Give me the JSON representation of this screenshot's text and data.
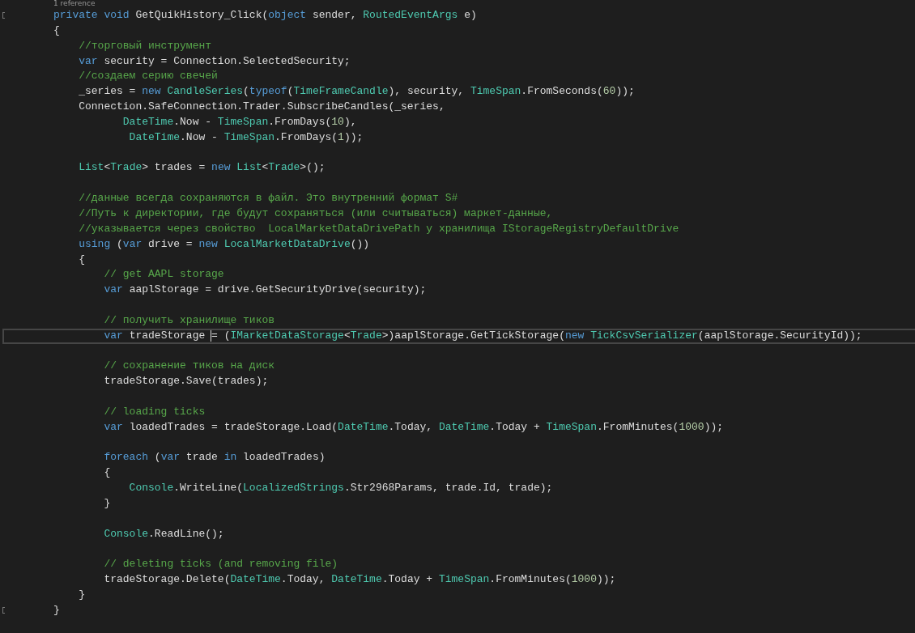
{
  "editor": {
    "codelens": "1 reference",
    "lines": [
      {
        "kind": "code",
        "margin_mark": true,
        "tokens": [
          {
            "kind": "keyword",
            "text": "private"
          },
          {
            "kind": "keyword",
            "text": " void"
          },
          {
            "kind": "plain",
            "text": " GetQuikHistory_Click("
          },
          {
            "kind": "keyword",
            "text": "object"
          },
          {
            "kind": "plain",
            "text": " sender, "
          },
          {
            "kind": "type",
            "text": "RoutedEventArgs"
          },
          {
            "kind": "plain",
            "text": " e)"
          }
        ]
      },
      {
        "kind": "code",
        "tokens": [
          {
            "kind": "plain",
            "text": "{"
          }
        ]
      },
      {
        "kind": "code",
        "tokens": [
          {
            "kind": "comment",
            "text": "    //торговый инструмент"
          }
        ]
      },
      {
        "kind": "code",
        "tokens": [
          {
            "kind": "keyword",
            "text": "    var"
          },
          {
            "kind": "plain",
            "text": " security = Connection.SelectedSecurity;"
          }
        ]
      },
      {
        "kind": "code",
        "tokens": [
          {
            "kind": "comment",
            "text": "    //создаем серию свечей"
          }
        ]
      },
      {
        "kind": "code",
        "tokens": [
          {
            "kind": "plain",
            "text": "    _series = "
          },
          {
            "kind": "keyword",
            "text": "new"
          },
          {
            "kind": "type",
            "text": " CandleSeries"
          },
          {
            "kind": "plain",
            "text": "("
          },
          {
            "kind": "keyword",
            "text": "typeof"
          },
          {
            "kind": "plain",
            "text": "("
          },
          {
            "kind": "type",
            "text": "TimeFrameCandle"
          },
          {
            "kind": "plain",
            "text": "), security, "
          },
          {
            "kind": "type",
            "text": "TimeSpan"
          },
          {
            "kind": "plain",
            "text": ".FromSeconds("
          },
          {
            "kind": "number",
            "text": "60"
          },
          {
            "kind": "plain",
            "text": "));"
          }
        ]
      },
      {
        "kind": "code",
        "tokens": [
          {
            "kind": "plain",
            "text": "    Connection.SafeConnection.Trader.SubscribeCandles(_series,"
          }
        ]
      },
      {
        "kind": "code",
        "tokens": [
          {
            "kind": "type",
            "text": "           DateTime"
          },
          {
            "kind": "plain",
            "text": ".Now - "
          },
          {
            "kind": "type",
            "text": "TimeSpan"
          },
          {
            "kind": "plain",
            "text": ".FromDays("
          },
          {
            "kind": "number",
            "text": "10"
          },
          {
            "kind": "plain",
            "text": "),"
          }
        ]
      },
      {
        "kind": "code",
        "tokens": [
          {
            "kind": "type",
            "text": "            DateTime"
          },
          {
            "kind": "plain",
            "text": ".Now - "
          },
          {
            "kind": "type",
            "text": "TimeSpan"
          },
          {
            "kind": "plain",
            "text": ".FromDays("
          },
          {
            "kind": "number",
            "text": "1"
          },
          {
            "kind": "plain",
            "text": "));"
          }
        ]
      },
      {
        "kind": "blank"
      },
      {
        "kind": "code",
        "tokens": [
          {
            "kind": "type",
            "text": "    List"
          },
          {
            "kind": "plain",
            "text": "<"
          },
          {
            "kind": "type",
            "text": "Trade"
          },
          {
            "kind": "plain",
            "text": "> trades = "
          },
          {
            "kind": "keyword",
            "text": "new"
          },
          {
            "kind": "type",
            "text": " List"
          },
          {
            "kind": "plain",
            "text": "<"
          },
          {
            "kind": "type",
            "text": "Trade"
          },
          {
            "kind": "plain",
            "text": ">();"
          }
        ]
      },
      {
        "kind": "blank"
      },
      {
        "kind": "code",
        "tokens": [
          {
            "kind": "comment",
            "text": "    //данные всегда сохраняются в файл. Это внутренний формат S#"
          }
        ]
      },
      {
        "kind": "code",
        "tokens": [
          {
            "kind": "comment",
            "text": "    //Путь к директории, где будут сохраняться (или считываться) маркет-данные,"
          }
        ]
      },
      {
        "kind": "code",
        "tokens": [
          {
            "kind": "comment",
            "text": "    //указывается через свойство  LocalMarketDataDrivePath у хранилища IStorageRegistryDefaultDrive"
          }
        ]
      },
      {
        "kind": "code",
        "tokens": [
          {
            "kind": "keyword",
            "text": "    using"
          },
          {
            "kind": "plain",
            "text": " ("
          },
          {
            "kind": "keyword",
            "text": "var"
          },
          {
            "kind": "plain",
            "text": " drive = "
          },
          {
            "kind": "keyword",
            "text": "new"
          },
          {
            "kind": "type",
            "text": " LocalMarketDataDrive"
          },
          {
            "kind": "plain",
            "text": "())"
          }
        ]
      },
      {
        "kind": "code",
        "tokens": [
          {
            "kind": "plain",
            "text": "    {"
          }
        ]
      },
      {
        "kind": "code",
        "tokens": [
          {
            "kind": "comment",
            "text": "        // get AAPL storage"
          }
        ]
      },
      {
        "kind": "code",
        "tokens": [
          {
            "kind": "keyword",
            "text": "        var"
          },
          {
            "kind": "plain",
            "text": " aaplStorage = drive.GetSecurityDrive(security);"
          }
        ]
      },
      {
        "kind": "blank"
      },
      {
        "kind": "code",
        "tokens": [
          {
            "kind": "comment",
            "text": "        // получить хранилище тиков"
          }
        ]
      },
      {
        "kind": "code",
        "current": true,
        "tokens": [
          {
            "kind": "keyword",
            "text": "        var"
          },
          {
            "kind": "plain",
            "text": " tradeStorage "
          },
          {
            "kind": "plain",
            "caret": true,
            "text": "="
          },
          {
            "kind": "plain",
            "text": " ("
          },
          {
            "kind": "type",
            "text": "IMarketDataStorage"
          },
          {
            "kind": "plain",
            "text": "<"
          },
          {
            "kind": "type",
            "text": "Trade"
          },
          {
            "kind": "plain",
            "text": ">)aaplStorage.GetTickStorage("
          },
          {
            "kind": "keyword",
            "text": "new"
          },
          {
            "kind": "type",
            "text": " TickCsvSerializer"
          },
          {
            "kind": "plain",
            "text": "(aaplStorage.SecurityId));"
          }
        ]
      },
      {
        "kind": "blank"
      },
      {
        "kind": "code",
        "tokens": [
          {
            "kind": "comment",
            "text": "        // сохранение тиков на диск"
          }
        ]
      },
      {
        "kind": "code",
        "tokens": [
          {
            "kind": "plain",
            "text": "        tradeStorage.Save(trades);"
          }
        ]
      },
      {
        "kind": "blank"
      },
      {
        "kind": "code",
        "tokens": [
          {
            "kind": "comment",
            "text": "        // loading ticks"
          }
        ]
      },
      {
        "kind": "code",
        "tokens": [
          {
            "kind": "keyword",
            "text": "        var"
          },
          {
            "kind": "plain",
            "text": " loadedTrades = tradeStorage.Load("
          },
          {
            "kind": "type",
            "text": "DateTime"
          },
          {
            "kind": "plain",
            "text": ".Today, "
          },
          {
            "kind": "type",
            "text": "DateTime"
          },
          {
            "kind": "plain",
            "text": ".Today + "
          },
          {
            "kind": "type",
            "text": "TimeSpan"
          },
          {
            "kind": "plain",
            "text": ".FromMinutes("
          },
          {
            "kind": "number",
            "text": "1000"
          },
          {
            "kind": "plain",
            "text": "));"
          }
        ]
      },
      {
        "kind": "blank"
      },
      {
        "kind": "code",
        "tokens": [
          {
            "kind": "keyword",
            "text": "        foreach"
          },
          {
            "kind": "plain",
            "text": " ("
          },
          {
            "kind": "keyword",
            "text": "var"
          },
          {
            "kind": "plain",
            "text": " trade "
          },
          {
            "kind": "keyword",
            "text": "in"
          },
          {
            "kind": "plain",
            "text": " loadedTrades)"
          }
        ]
      },
      {
        "kind": "code",
        "tokens": [
          {
            "kind": "plain",
            "text": "        {"
          }
        ]
      },
      {
        "kind": "code",
        "tokens": [
          {
            "kind": "type",
            "text": "            Console"
          },
          {
            "kind": "plain",
            "text": ".WriteLine("
          },
          {
            "kind": "type",
            "text": "LocalizedStrings"
          },
          {
            "kind": "plain",
            "text": ".Str2968Params, trade.Id, trade);"
          }
        ]
      },
      {
        "kind": "code",
        "tokens": [
          {
            "kind": "plain",
            "text": "        }"
          }
        ]
      },
      {
        "kind": "blank"
      },
      {
        "kind": "code",
        "tokens": [
          {
            "kind": "type",
            "text": "        Console"
          },
          {
            "kind": "plain",
            "text": ".ReadLine();"
          }
        ]
      },
      {
        "kind": "blank"
      },
      {
        "kind": "code",
        "tokens": [
          {
            "kind": "comment",
            "text": "        // deleting ticks (and removing file)"
          }
        ]
      },
      {
        "kind": "code",
        "tokens": [
          {
            "kind": "plain",
            "text": "        tradeStorage.Delete("
          },
          {
            "kind": "type",
            "text": "DateTime"
          },
          {
            "kind": "plain",
            "text": ".Today, "
          },
          {
            "kind": "type",
            "text": "DateTime"
          },
          {
            "kind": "plain",
            "text": ".Today + "
          },
          {
            "kind": "type",
            "text": "TimeSpan"
          },
          {
            "kind": "plain",
            "text": ".FromMinutes("
          },
          {
            "kind": "number",
            "text": "1000"
          },
          {
            "kind": "plain",
            "text": "));"
          }
        ]
      },
      {
        "kind": "code",
        "tokens": [
          {
            "kind": "plain",
            "text": "    }"
          }
        ]
      },
      {
        "kind": "code",
        "margin_mark": true,
        "tokens": [
          {
            "kind": "plain",
            "text": "}"
          }
        ]
      }
    ]
  }
}
